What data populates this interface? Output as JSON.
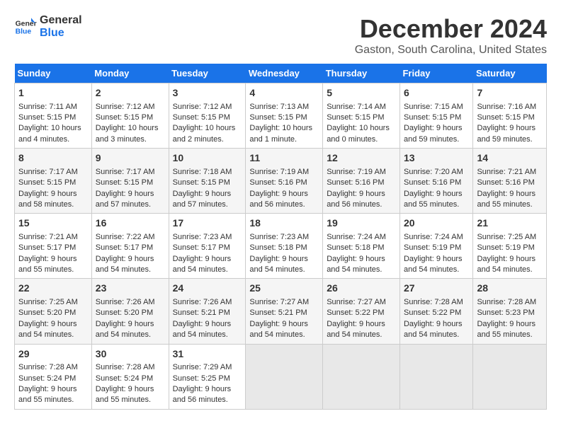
{
  "logo": {
    "line1": "General",
    "line2": "Blue"
  },
  "title": "December 2024",
  "subtitle": "Gaston, South Carolina, United States",
  "days_header": [
    "Sunday",
    "Monday",
    "Tuesday",
    "Wednesday",
    "Thursday",
    "Friday",
    "Saturday"
  ],
  "weeks": [
    [
      {
        "day": "1",
        "info": "Sunrise: 7:11 AM\nSunset: 5:15 PM\nDaylight: 10 hours\nand 4 minutes."
      },
      {
        "day": "2",
        "info": "Sunrise: 7:12 AM\nSunset: 5:15 PM\nDaylight: 10 hours\nand 3 minutes."
      },
      {
        "day": "3",
        "info": "Sunrise: 7:12 AM\nSunset: 5:15 PM\nDaylight: 10 hours\nand 2 minutes."
      },
      {
        "day": "4",
        "info": "Sunrise: 7:13 AM\nSunset: 5:15 PM\nDaylight: 10 hours\nand 1 minute."
      },
      {
        "day": "5",
        "info": "Sunrise: 7:14 AM\nSunset: 5:15 PM\nDaylight: 10 hours\nand 0 minutes."
      },
      {
        "day": "6",
        "info": "Sunrise: 7:15 AM\nSunset: 5:15 PM\nDaylight: 9 hours\nand 59 minutes."
      },
      {
        "day": "7",
        "info": "Sunrise: 7:16 AM\nSunset: 5:15 PM\nDaylight: 9 hours\nand 59 minutes."
      }
    ],
    [
      {
        "day": "8",
        "info": "Sunrise: 7:17 AM\nSunset: 5:15 PM\nDaylight: 9 hours\nand 58 minutes."
      },
      {
        "day": "9",
        "info": "Sunrise: 7:17 AM\nSunset: 5:15 PM\nDaylight: 9 hours\nand 57 minutes."
      },
      {
        "day": "10",
        "info": "Sunrise: 7:18 AM\nSunset: 5:15 PM\nDaylight: 9 hours\nand 57 minutes."
      },
      {
        "day": "11",
        "info": "Sunrise: 7:19 AM\nSunset: 5:16 PM\nDaylight: 9 hours\nand 56 minutes."
      },
      {
        "day": "12",
        "info": "Sunrise: 7:19 AM\nSunset: 5:16 PM\nDaylight: 9 hours\nand 56 minutes."
      },
      {
        "day": "13",
        "info": "Sunrise: 7:20 AM\nSunset: 5:16 PM\nDaylight: 9 hours\nand 55 minutes."
      },
      {
        "day": "14",
        "info": "Sunrise: 7:21 AM\nSunset: 5:16 PM\nDaylight: 9 hours\nand 55 minutes."
      }
    ],
    [
      {
        "day": "15",
        "info": "Sunrise: 7:21 AM\nSunset: 5:17 PM\nDaylight: 9 hours\nand 55 minutes."
      },
      {
        "day": "16",
        "info": "Sunrise: 7:22 AM\nSunset: 5:17 PM\nDaylight: 9 hours\nand 54 minutes."
      },
      {
        "day": "17",
        "info": "Sunrise: 7:23 AM\nSunset: 5:17 PM\nDaylight: 9 hours\nand 54 minutes."
      },
      {
        "day": "18",
        "info": "Sunrise: 7:23 AM\nSunset: 5:18 PM\nDaylight: 9 hours\nand 54 minutes."
      },
      {
        "day": "19",
        "info": "Sunrise: 7:24 AM\nSunset: 5:18 PM\nDaylight: 9 hours\nand 54 minutes."
      },
      {
        "day": "20",
        "info": "Sunrise: 7:24 AM\nSunset: 5:19 PM\nDaylight: 9 hours\nand 54 minutes."
      },
      {
        "day": "21",
        "info": "Sunrise: 7:25 AM\nSunset: 5:19 PM\nDaylight: 9 hours\nand 54 minutes."
      }
    ],
    [
      {
        "day": "22",
        "info": "Sunrise: 7:25 AM\nSunset: 5:20 PM\nDaylight: 9 hours\nand 54 minutes."
      },
      {
        "day": "23",
        "info": "Sunrise: 7:26 AM\nSunset: 5:20 PM\nDaylight: 9 hours\nand 54 minutes."
      },
      {
        "day": "24",
        "info": "Sunrise: 7:26 AM\nSunset: 5:21 PM\nDaylight: 9 hours\nand 54 minutes."
      },
      {
        "day": "25",
        "info": "Sunrise: 7:27 AM\nSunset: 5:21 PM\nDaylight: 9 hours\nand 54 minutes."
      },
      {
        "day": "26",
        "info": "Sunrise: 7:27 AM\nSunset: 5:22 PM\nDaylight: 9 hours\nand 54 minutes."
      },
      {
        "day": "27",
        "info": "Sunrise: 7:28 AM\nSunset: 5:22 PM\nDaylight: 9 hours\nand 54 minutes."
      },
      {
        "day": "28",
        "info": "Sunrise: 7:28 AM\nSunset: 5:23 PM\nDaylight: 9 hours\nand 55 minutes."
      }
    ],
    [
      {
        "day": "29",
        "info": "Sunrise: 7:28 AM\nSunset: 5:24 PM\nDaylight: 9 hours\nand 55 minutes."
      },
      {
        "day": "30",
        "info": "Sunrise: 7:28 AM\nSunset: 5:24 PM\nDaylight: 9 hours\nand 55 minutes."
      },
      {
        "day": "31",
        "info": "Sunrise: 7:29 AM\nSunset: 5:25 PM\nDaylight: 9 hours\nand 56 minutes."
      },
      {
        "day": "",
        "info": ""
      },
      {
        "day": "",
        "info": ""
      },
      {
        "day": "",
        "info": ""
      },
      {
        "day": "",
        "info": ""
      }
    ]
  ]
}
